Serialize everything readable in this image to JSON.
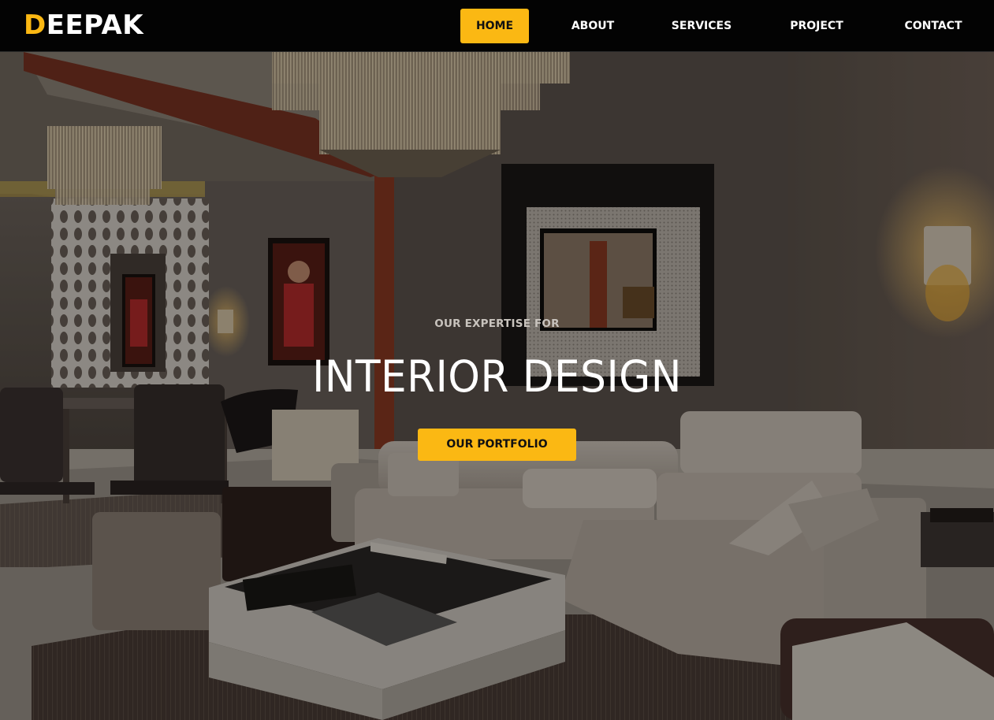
{
  "brand": {
    "first_letter": "D",
    "rest": "EEPAK"
  },
  "nav": {
    "items": [
      {
        "label": "HOME",
        "active": true
      },
      {
        "label": "ABOUT",
        "active": false
      },
      {
        "label": "SERVICES",
        "active": false
      },
      {
        "label": "PROJECT",
        "active": false
      },
      {
        "label": "CONTACT",
        "active": false
      }
    ]
  },
  "hero": {
    "subtitle": "OUR EXPERTISE FOR",
    "title": "INTERIOR DESIGN",
    "cta_label": "OUR PORTFOLIO",
    "background_image": "living-room-interior-photo"
  },
  "colors": {
    "accent": "#fbb813",
    "navbar": "#030303",
    "text_light": "#ffffff"
  }
}
